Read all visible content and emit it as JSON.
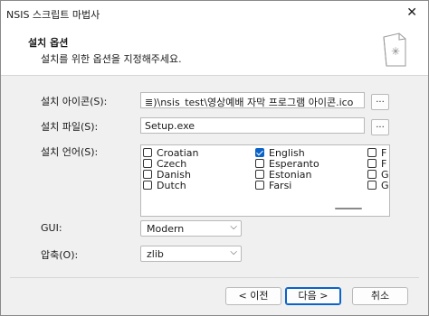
{
  "window": {
    "title": "NSIS 스크립트 마법사",
    "close_glyph": "✕"
  },
  "header": {
    "title": "설치 옵션",
    "subtitle": "설치를 위한 옵션을 지정해주세요."
  },
  "icon_field": {
    "label": "설치 아이콘(S):",
    "value": "≣)\\nsis_test\\영상예배 자막 프로그램 아이콘.ico",
    "browse": "..."
  },
  "file_field": {
    "label": "설치 파일(S):",
    "value": "Setup.exe",
    "browse": "..."
  },
  "languages": {
    "label": "설치 언어(S):",
    "col1": [
      {
        "name": "Croatian",
        "checked": false
      },
      {
        "name": "Czech",
        "checked": false
      },
      {
        "name": "Danish",
        "checked": false
      },
      {
        "name": "Dutch",
        "checked": false
      }
    ],
    "col2": [
      {
        "name": "English",
        "checked": true
      },
      {
        "name": "Esperanto",
        "checked": false
      },
      {
        "name": "Estonian",
        "checked": false
      },
      {
        "name": "Farsi",
        "checked": false
      }
    ],
    "col3": [
      {
        "name": "F",
        "checked": false
      },
      {
        "name": "F",
        "checked": false
      },
      {
        "name": "G",
        "checked": false
      },
      {
        "name": "G",
        "checked": false
      }
    ]
  },
  "gui": {
    "label": "GUI:",
    "value": "Modern"
  },
  "compress": {
    "label": "압축(O):",
    "value": "zlib"
  },
  "buttons": {
    "back": "< 이전",
    "next": "다음 >",
    "cancel": "취소"
  },
  "colors": {
    "accent": "#0a63c9",
    "window_bg": "#f0f0f0"
  }
}
